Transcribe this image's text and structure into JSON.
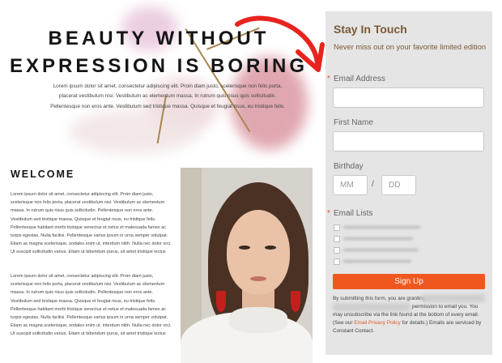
{
  "hero": {
    "title_line1": "BEAUTY WITHOUT",
    "title_line2": "EXPRESSION IS BORING",
    "body": "Lorem ipsum dolor sit amet, consectetur adipiscing elit. Proin diam justo, scelerisque non felis porta, placerat vestibulum nisi. Vestibulum ac elementum massa. In rutrum quis risus quis sollicitudin. Pellentesque non eros ante. Vestibulum sed tristique massa. Quisque et feugiat risus, eu tristique felis."
  },
  "welcome": {
    "title": "WELCOME",
    "para1": "Lorem ipsum dolor sit amet, consectetur adipiscing elit. Proin diam justo, scelerisque non felis porta, placerat vestibulum nisi. Vestibulum ac elementum massa. In rutrum quis risus quis sollicitudin. Pellentesque non eros ante. Vestibulum sed tristique massa. Quisque et feugiat risus, eu tristique felis. Pellentesque habitant morbi tristique senectus et netus et malesuada fames ac turpis egestas. Nulla facilisi. Pellentesque varius ipsum in urna semper volutpat. Etiam ac magna scelerisque, sodales enim ut, interdum nibh. Nulla nec dolor orci. Ut suscipit sollicitudin varius. Etiam ut bibendum purus, sit amet tristique lectus",
    "para2": "Lorem ipsum dolor sit amet, consectetur adipiscing elit. Proin diam justo, scelerisque non felis porta, placerat vestibulum nisi. Vestibulum ac elementum massa. In rutrum quis risus quis sollicitudin. Pellentesque non eros ante. Vestibulum sed tristique massa. Quisque et feugiat risus, eu tristique felis. Pellentesque habitant morbi tristique senectus et netus et malesuada fames ac turpis egestas. Nulla facilisi. Pellentesque varius ipsum in urna semper volutpat. Etiam ac magna scelerisque, sodales enim ut, interdum nibh. Nulla nec dolor orci. Ut suscipit sollicitudin varius. Etiam ut bibendum purus, sit amet tristique lectus"
  },
  "form": {
    "title": "Stay In Touch",
    "subtitle": "Never miss out on your favorite limited edition",
    "required_mark": "*",
    "email_label": "Email Address",
    "first_name_label": "First Name",
    "birthday_label": "Birthday",
    "month_placeholder": "MM",
    "day_placeholder": "DD",
    "date_separator": "/",
    "email_lists_label": "Email Lists",
    "submit_label": "Sign Up",
    "disclaimer_line1": "By submitting this form, you are granting",
    "disclaimer_line2": "permission to email you. You",
    "disclaimer_line3": "may unsubscribe via the link found at the bottom of every email.",
    "disclaimer_line4_pre": "(See our ",
    "disclaimer_link": "Email Privacy Policy",
    "disclaimer_line4_post": " for details.) Emails are serviced by",
    "disclaimer_line5": "Constant Contact."
  },
  "colors": {
    "accent": "#f0571f",
    "form_heading": "#7a5a37",
    "arrow": "#e8231e",
    "panel_bg": "#e5e5e5"
  }
}
